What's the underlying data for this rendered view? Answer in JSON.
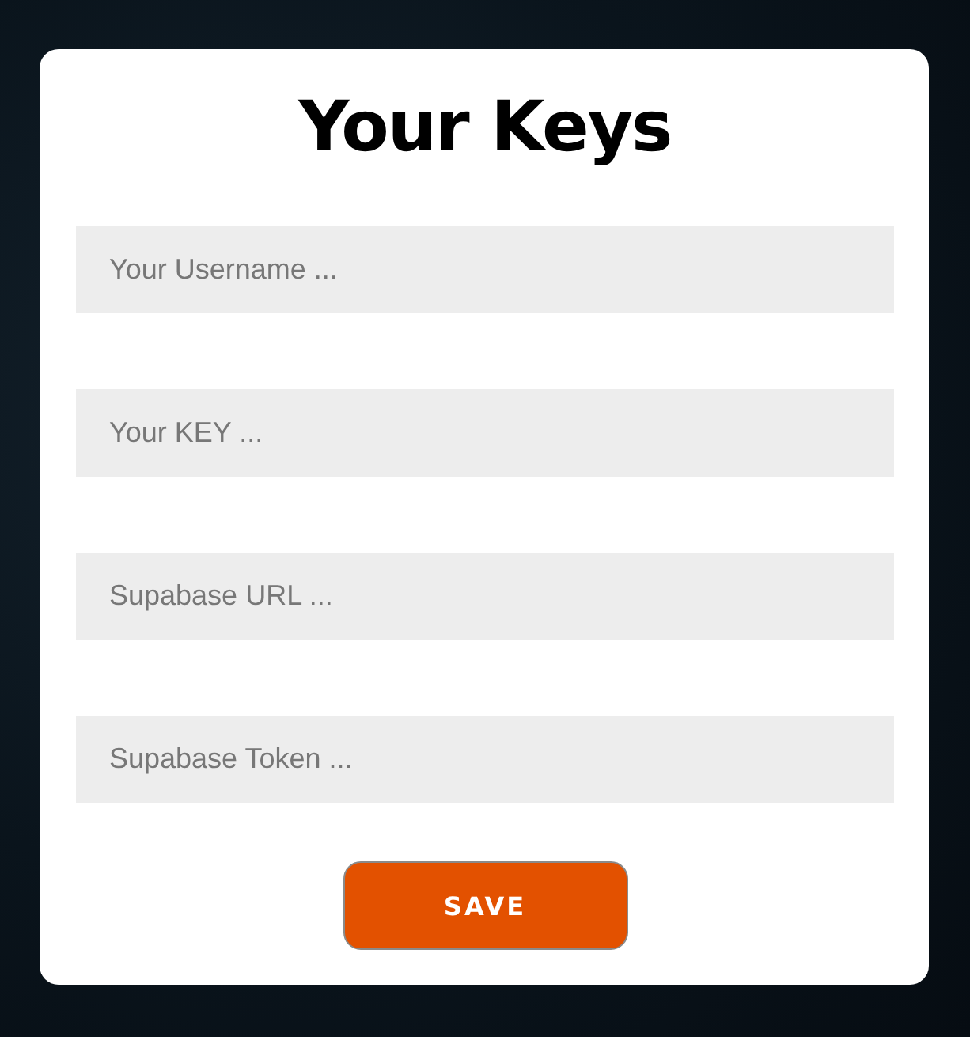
{
  "title": "Your Keys",
  "fields": [
    {
      "placeholder": "Your Username ..."
    },
    {
      "placeholder": "Your KEY ..."
    },
    {
      "placeholder": "Supabase URL ..."
    },
    {
      "placeholder": "Supabase Token ..."
    }
  ],
  "button": "SAVE"
}
